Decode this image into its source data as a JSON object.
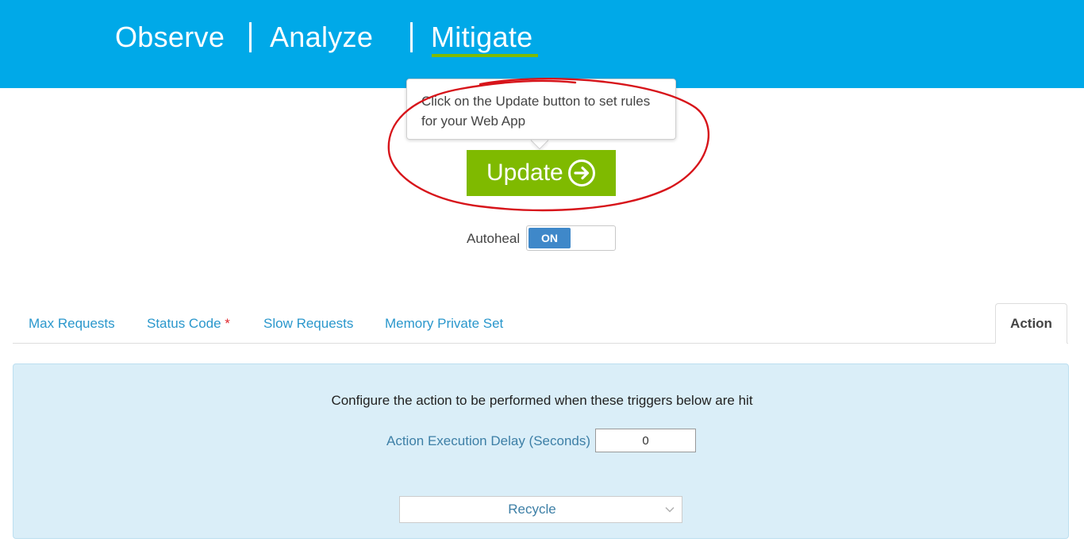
{
  "nav": {
    "items": [
      {
        "label": "Observe"
      },
      {
        "label": "Analyze"
      },
      {
        "label": "Mitigate"
      }
    ],
    "active": "Mitigate"
  },
  "tooltip": {
    "line1": "Click on the Update button to set rules",
    "line2": "for your Web App"
  },
  "update_button": {
    "label": "Update",
    "icon": "arrow-right-circle-icon"
  },
  "autoheal": {
    "label": "Autoheal",
    "state": "ON"
  },
  "tabs": [
    {
      "label": "Max Requests"
    },
    {
      "label": "Status Code",
      "required_mark": "*"
    },
    {
      "label": "Slow Requests"
    },
    {
      "label": "Memory Private Set"
    },
    {
      "label": "Action",
      "active": true
    }
  ],
  "action_panel": {
    "heading": "Configure the action to be performed when these triggers below are hit",
    "delay_label": "Action Execution Delay (Seconds)",
    "delay_value": "0",
    "action_select": {
      "selected": "Recycle"
    }
  },
  "colors": {
    "header_bg": "#00a9e8",
    "accent_green": "#7fba00",
    "toggle_blue": "#3f88c9",
    "annotation_red": "#d7141a",
    "panel_bg": "#daeef8"
  }
}
